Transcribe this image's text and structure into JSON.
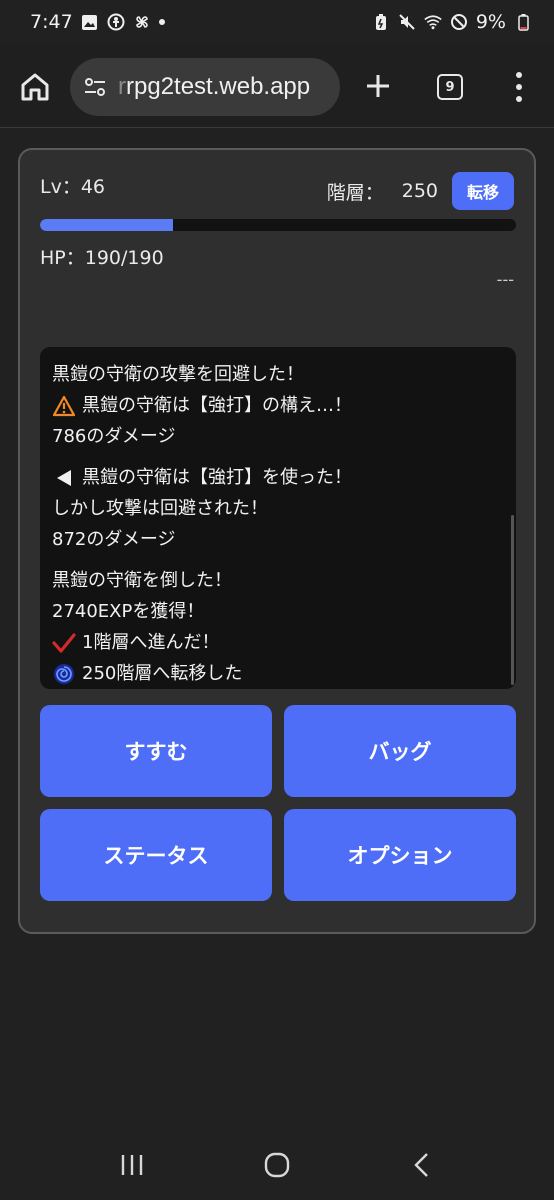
{
  "status_bar": {
    "time": "7:47",
    "battery": "9%"
  },
  "browser": {
    "url_faded": "r",
    "url": "rpg2test.web.app",
    "tab_count": "9"
  },
  "game": {
    "level_label": "Lv：46",
    "floor_label": "階層：",
    "floor_value": "250",
    "warp_label": "転移",
    "exp_progress": 0.28,
    "hp_label": "HP：190/190",
    "enemy_status": "---",
    "log": [
      [
        {
          "icon": "",
          "text": "黒鎧の守衛の攻撃を回避した！"
        },
        {
          "icon": "warning-icon",
          "text": "黒鎧の守衛は【強打】の構え…！"
        },
        {
          "icon": "",
          "text": "786のダメージ"
        }
      ],
      [
        {
          "icon": "left-triangle-icon",
          "text": "黒鎧の守衛は【強打】を使った！"
        },
        {
          "icon": "",
          "text": "しかし攻撃は回避された！"
        },
        {
          "icon": "",
          "text": "872のダメージ"
        }
      ],
      [
        {
          "icon": "",
          "text": "黒鎧の守衛を倒した！"
        },
        {
          "icon": "",
          "text": "2740EXPを獲得！"
        },
        {
          "icon": "check-mark-icon",
          "text": "1階層へ進んだ！"
        },
        {
          "icon": "swirl-icon",
          "text": "250階層へ転移した"
        }
      ]
    ],
    "actions": [
      "すすむ",
      "バッグ",
      "ステータス",
      "オプション"
    ]
  },
  "colors": {
    "accent": "#4f6ef7",
    "card": "#2f2f2f",
    "log_bg": "#121212"
  }
}
